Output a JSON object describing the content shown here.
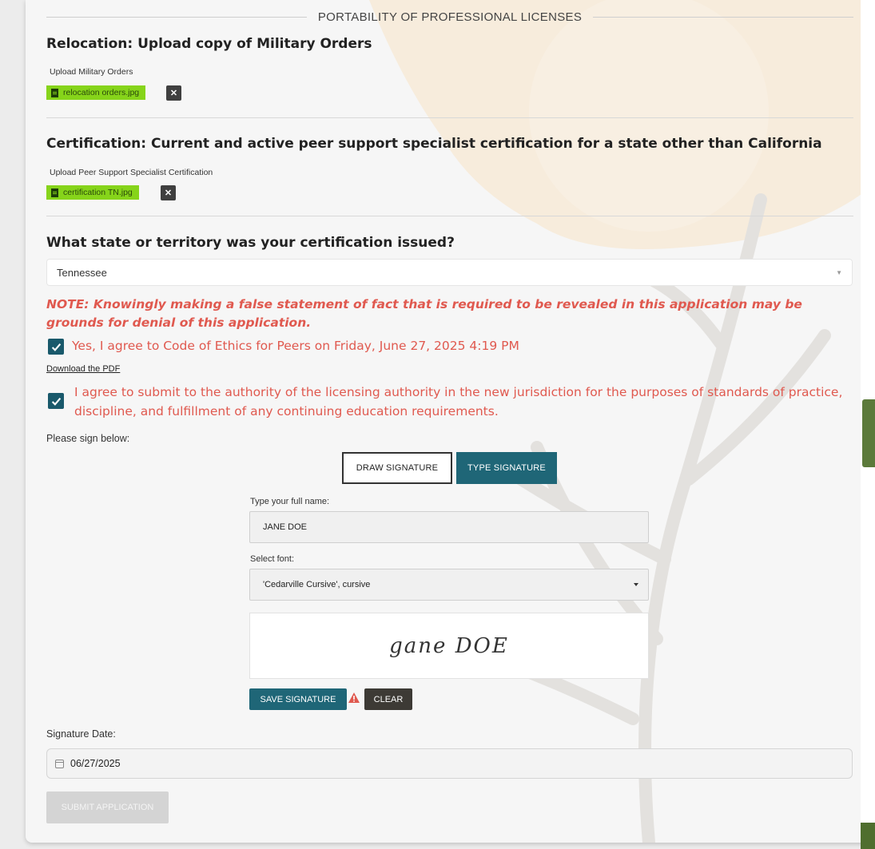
{
  "section": {
    "title": "PORTABILITY OF PROFESSIONAL LICENSES"
  },
  "relocation": {
    "heading": "Relocation: Upload copy of Military Orders",
    "upload_label": "Upload Military Orders",
    "file_name": "relocation orders.jpg",
    "remove_glyph": "✕"
  },
  "certification": {
    "heading": "Certification: Current and active peer support specialist certification for a state other than California",
    "upload_label": "Upload Peer Support Specialist Certification",
    "file_name": "certification TN.jpg",
    "remove_glyph": "✕"
  },
  "state": {
    "question": "What state or territory was your certification issued?",
    "selected": "Tennessee"
  },
  "note": "NOTE: Knowingly making a false statement of fact that is required to be revealed in this application may be grounds for denial of this application.",
  "ethics": {
    "checked": true,
    "label": "Yes, I agree to Code of Ethics for Peers on Friday, June 27, 2025 4:19 PM",
    "download_link": "Download the PDF"
  },
  "authority": {
    "checked": true,
    "line1": "I agree to submit to the authority of the licensing authority in the new jurisdiction for the purposes of standards of practice,",
    "line2": "discipline, and fulfillment of any continuing education requirements."
  },
  "signature": {
    "prompt": "Please sign below:",
    "tab_draw": "DRAW SIGNATURE",
    "tab_type": "TYPE SIGNATURE",
    "name_label": "Type your full name:",
    "name_value": "JANE DOE",
    "font_label": "Select font:",
    "font_value": "'Cedarville Cursive', cursive",
    "preview": "gane DOE",
    "save_label": "SAVE SIGNATURE",
    "clear_label": "CLEAR"
  },
  "signature_date": {
    "label": "Signature Date:",
    "value": "06/27/2025"
  },
  "submit_label": "SUBMIT APPLICATION",
  "colors": {
    "accent": "#1f6677",
    "warning_text": "#e0594f",
    "file_chip": "#86d41a"
  }
}
